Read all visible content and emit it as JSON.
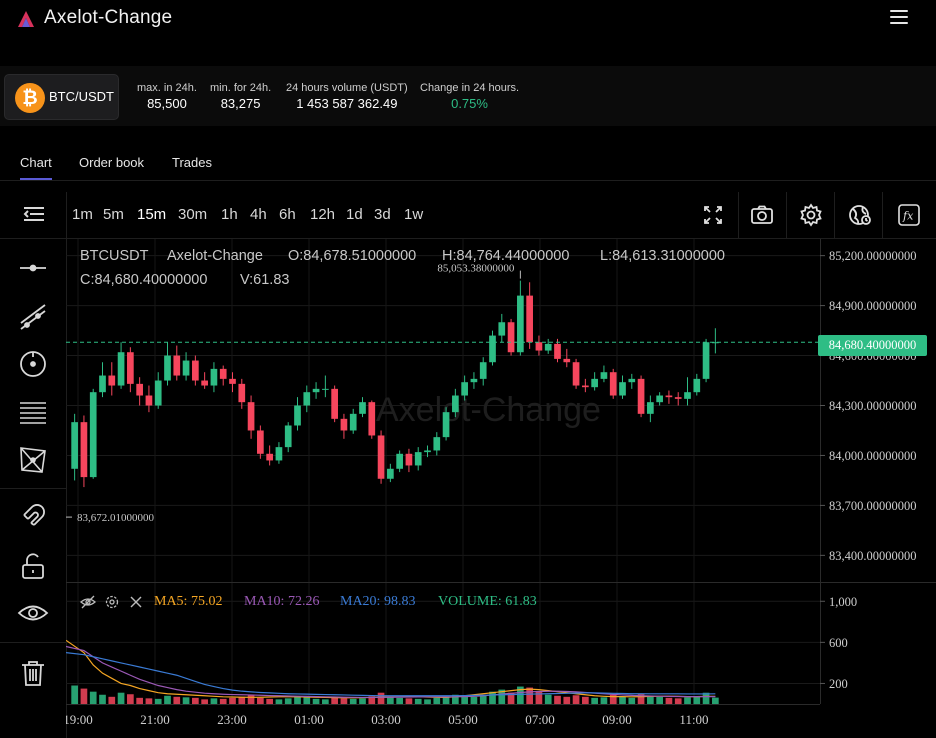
{
  "header": {
    "title": "Axelot-Change"
  },
  "stats": {
    "pair": "BTC/USDT",
    "items": [
      {
        "label": "max. in 24h.",
        "value": "85,500"
      },
      {
        "label": "min. for 24h.",
        "value": "83,275"
      },
      {
        "label": "24 hours volume (USDT)",
        "value": "1 453 587 362.49"
      },
      {
        "label": "Change in 24 hours.",
        "value": "0.75%"
      }
    ]
  },
  "tabs": [
    "Chart",
    "Order book",
    "Trades"
  ],
  "intervals": [
    "1m",
    "5m",
    "15m",
    "30m",
    "1h",
    "4h",
    "6h",
    "12h",
    "1d",
    "3d",
    "1w"
  ],
  "active_interval": "15m",
  "ohlc": {
    "symbol": "BTCUSDT",
    "exchange": "Axelot-Change",
    "open": "O:84,678.51000000",
    "high": "H:84,764.44000000",
    "low": "L:84,613.31000000",
    "close": "C:84,680.40000000",
    "volume": "V:61.83"
  },
  "watermark": "Axelot-Change",
  "indicators": {
    "ma5": "MA5: 75.02",
    "ma10": "MA10: 72.26",
    "ma20": "MA20: 98.83",
    "volume": "VOLUME: 61.83"
  },
  "colors": {
    "up": "#2ebd85",
    "down": "#f6465d",
    "ma5": "#f5a623",
    "ma10": "#9b59b6",
    "ma20": "#3a7bd5",
    "accent": "#5b5bd6"
  },
  "chart_data": {
    "type": "candlestick",
    "last_price_label": "84,680.40000000",
    "max_label": "85,053.38000000",
    "min_label": "83,672.01000000",
    "price_ticks": [
      "85,200.00000000",
      "84,900.00000000",
      "84,600.00000000",
      "84,300.00000000",
      "84,000.00000000",
      "83,700.00000000",
      "83,400.00000000"
    ],
    "price_tick_values": [
      85200,
      84900,
      84600,
      84300,
      84000,
      83700,
      83400
    ],
    "volume_ticks": [
      "1,000",
      "600",
      "200"
    ],
    "volume_tick_values": [
      1000,
      600,
      200
    ],
    "time_ticks": [
      "19:00",
      "21:00",
      "23:00",
      "01:00",
      "03:00",
      "05:00",
      "07:00",
      "09:00",
      "11:00"
    ],
    "price_range": [
      83240,
      85300
    ],
    "volume_range": [
      0,
      1100
    ],
    "candles": [
      [
        83920,
        84200,
        83850,
        84250
      ],
      [
        84200,
        83870,
        83810,
        84240
      ],
      [
        83870,
        84380,
        83860,
        84400
      ],
      [
        84380,
        84480,
        84350,
        84560
      ],
      [
        84480,
        84420,
        84360,
        84560
      ],
      [
        84420,
        84620,
        84400,
        84680
      ],
      [
        84620,
        84430,
        84380,
        84650
      ],
      [
        84430,
        84360,
        84300,
        84470
      ],
      [
        84360,
        84300,
        84260,
        84420
      ],
      [
        84300,
        84450,
        84280,
        84500
      ],
      [
        84450,
        84600,
        84420,
        84680
      ],
      [
        84600,
        84480,
        84450,
        84660
      ],
      [
        84480,
        84570,
        84450,
        84620
      ],
      [
        84570,
        84450,
        84420,
        84600
      ],
      [
        84450,
        84420,
        84400,
        84500
      ],
      [
        84420,
        84520,
        84380,
        84560
      ],
      [
        84520,
        84460,
        84420,
        84540
      ],
      [
        84460,
        84430,
        84380,
        84500
      ],
      [
        84430,
        84320,
        84280,
        84460
      ],
      [
        84320,
        84150,
        84100,
        84360
      ],
      [
        84150,
        84010,
        83980,
        84180
      ],
      [
        84010,
        83970,
        83940,
        84060
      ],
      [
        83970,
        84050,
        83950,
        84080
      ],
      [
        84050,
        84180,
        84020,
        84200
      ],
      [
        84180,
        84300,
        84150,
        84350
      ],
      [
        84300,
        84380,
        84260,
        84420
      ],
      [
        84380,
        84400,
        84340,
        84440
      ],
      [
        84400,
        84400,
        84350,
        84480
      ],
      [
        84400,
        84220,
        84200,
        84420
      ],
      [
        84220,
        84150,
        84100,
        84250
      ],
      [
        84150,
        84250,
        84130,
        84280
      ],
      [
        84250,
        84320,
        84230,
        84350
      ],
      [
        84320,
        84120,
        84100,
        84330
      ],
      [
        84120,
        83860,
        83830,
        84150
      ],
      [
        83860,
        83920,
        83840,
        83950
      ],
      [
        83920,
        84010,
        83900,
        84030
      ],
      [
        84010,
        83940,
        83900,
        84040
      ],
      [
        83940,
        84020,
        83910,
        84050
      ],
      [
        84020,
        84030,
        83990,
        84060
      ],
      [
        84030,
        84110,
        84000,
        84140
      ],
      [
        84110,
        84260,
        84090,
        84290
      ],
      [
        84260,
        84360,
        84230,
        84400
      ],
      [
        84360,
        84440,
        84330,
        84480
      ],
      [
        84440,
        84460,
        84400,
        84500
      ],
      [
        84460,
        84560,
        84420,
        84590
      ],
      [
        84560,
        84720,
        84540,
        84750
      ],
      [
        84720,
        84800,
        84680,
        84850
      ],
      [
        84800,
        84620,
        84600,
        84820
      ],
      [
        84620,
        84960,
        84600,
        85050
      ],
      [
        84960,
        84680,
        84640,
        85040
      ],
      [
        84680,
        84630,
        84600,
        84720
      ],
      [
        84630,
        84670,
        84610,
        84700
      ],
      [
        84670,
        84580,
        84560,
        84700
      ],
      [
        84580,
        84560,
        84530,
        84640
      ],
      [
        84560,
        84420,
        84400,
        84580
      ],
      [
        84420,
        84410,
        84380,
        84460
      ],
      [
        84410,
        84460,
        84390,
        84500
      ],
      [
        84460,
        84500,
        84440,
        84540
      ],
      [
        84500,
        84360,
        84340,
        84520
      ],
      [
        84360,
        84440,
        84340,
        84480
      ],
      [
        84440,
        84460,
        84400,
        84490
      ],
      [
        84460,
        84250,
        84230,
        84480
      ],
      [
        84250,
        84320,
        84200,
        84360
      ],
      [
        84320,
        84360,
        84300,
        84380
      ],
      [
        84360,
        84350,
        84310,
        84390
      ],
      [
        84350,
        84340,
        84300,
        84380
      ],
      [
        84340,
        84380,
        84300,
        84470
      ],
      [
        84380,
        84460,
        84360,
        84490
      ],
      [
        84460,
        84680,
        84440,
        84700
      ],
      [
        84680,
        84680,
        84613,
        84764
      ]
    ],
    "volumes": [
      180,
      150,
      120,
      90,
      70,
      110,
      95,
      60,
      55,
      50,
      80,
      70,
      65,
      60,
      45,
      55,
      50,
      60,
      70,
      90,
      60,
      50,
      45,
      55,
      70,
      65,
      50,
      45,
      60,
      55,
      50,
      55,
      75,
      110,
      70,
      60,
      55,
      50,
      45,
      60,
      75,
      90,
      85,
      70,
      80,
      120,
      140,
      110,
      170,
      160,
      120,
      90,
      80,
      70,
      85,
      70,
      60,
      65,
      90,
      70,
      60,
      95,
      80,
      70,
      60,
      55,
      65,
      75,
      110,
      62
    ],
    "ma5": [
      620,
      500,
      380,
      300,
      250,
      200,
      180,
      150,
      130,
      110,
      100,
      95,
      90,
      85,
      80,
      75,
      70,
      68,
      66,
      65,
      66,
      68,
      70,
      72,
      70,
      68,
      66,
      64,
      62,
      60,
      60,
      62,
      64,
      66,
      68,
      70,
      72,
      70,
      68,
      66,
      64,
      70,
      80,
      90,
      100,
      110,
      120,
      130,
      140,
      145,
      140,
      130,
      120,
      110,
      100,
      90,
      80,
      75,
      72,
      72,
      70,
      72,
      74,
      76,
      76,
      74,
      72,
      72,
      74,
      75
    ],
    "ma10": [
      560,
      520,
      460,
      400,
      360,
      320,
      280,
      240,
      210,
      180,
      160,
      140,
      125,
      115,
      105,
      100,
      95,
      92,
      90,
      88,
      85,
      82,
      80,
      78,
      76,
      74,
      72,
      70,
      68,
      66,
      65,
      64,
      64,
      65,
      66,
      67,
      68,
      69,
      70,
      70,
      69,
      70,
      72,
      75,
      80,
      88,
      96,
      104,
      112,
      118,
      122,
      124,
      124,
      122,
      118,
      112,
      106,
      100,
      94,
      88,
      84,
      80,
      78,
      76,
      74,
      73,
      72,
      72,
      72,
      72
    ],
    "ma20": [
      500,
      480,
      460,
      440,
      420,
      400,
      380,
      360,
      340,
      320,
      300,
      280,
      250,
      220,
      190,
      170,
      150,
      135,
      125,
      118,
      112,
      108,
      104,
      100,
      98,
      96,
      94,
      92,
      90,
      88,
      86,
      84,
      82,
      80,
      80,
      80,
      80,
      80,
      80,
      80,
      80,
      81,
      82,
      84,
      86,
      88,
      90,
      92,
      94,
      96,
      98,
      100,
      102,
      104,
      106,
      108,
      108,
      106,
      104,
      102,
      100,
      100,
      99,
      99,
      99,
      99,
      98,
      98,
      98,
      99
    ]
  }
}
